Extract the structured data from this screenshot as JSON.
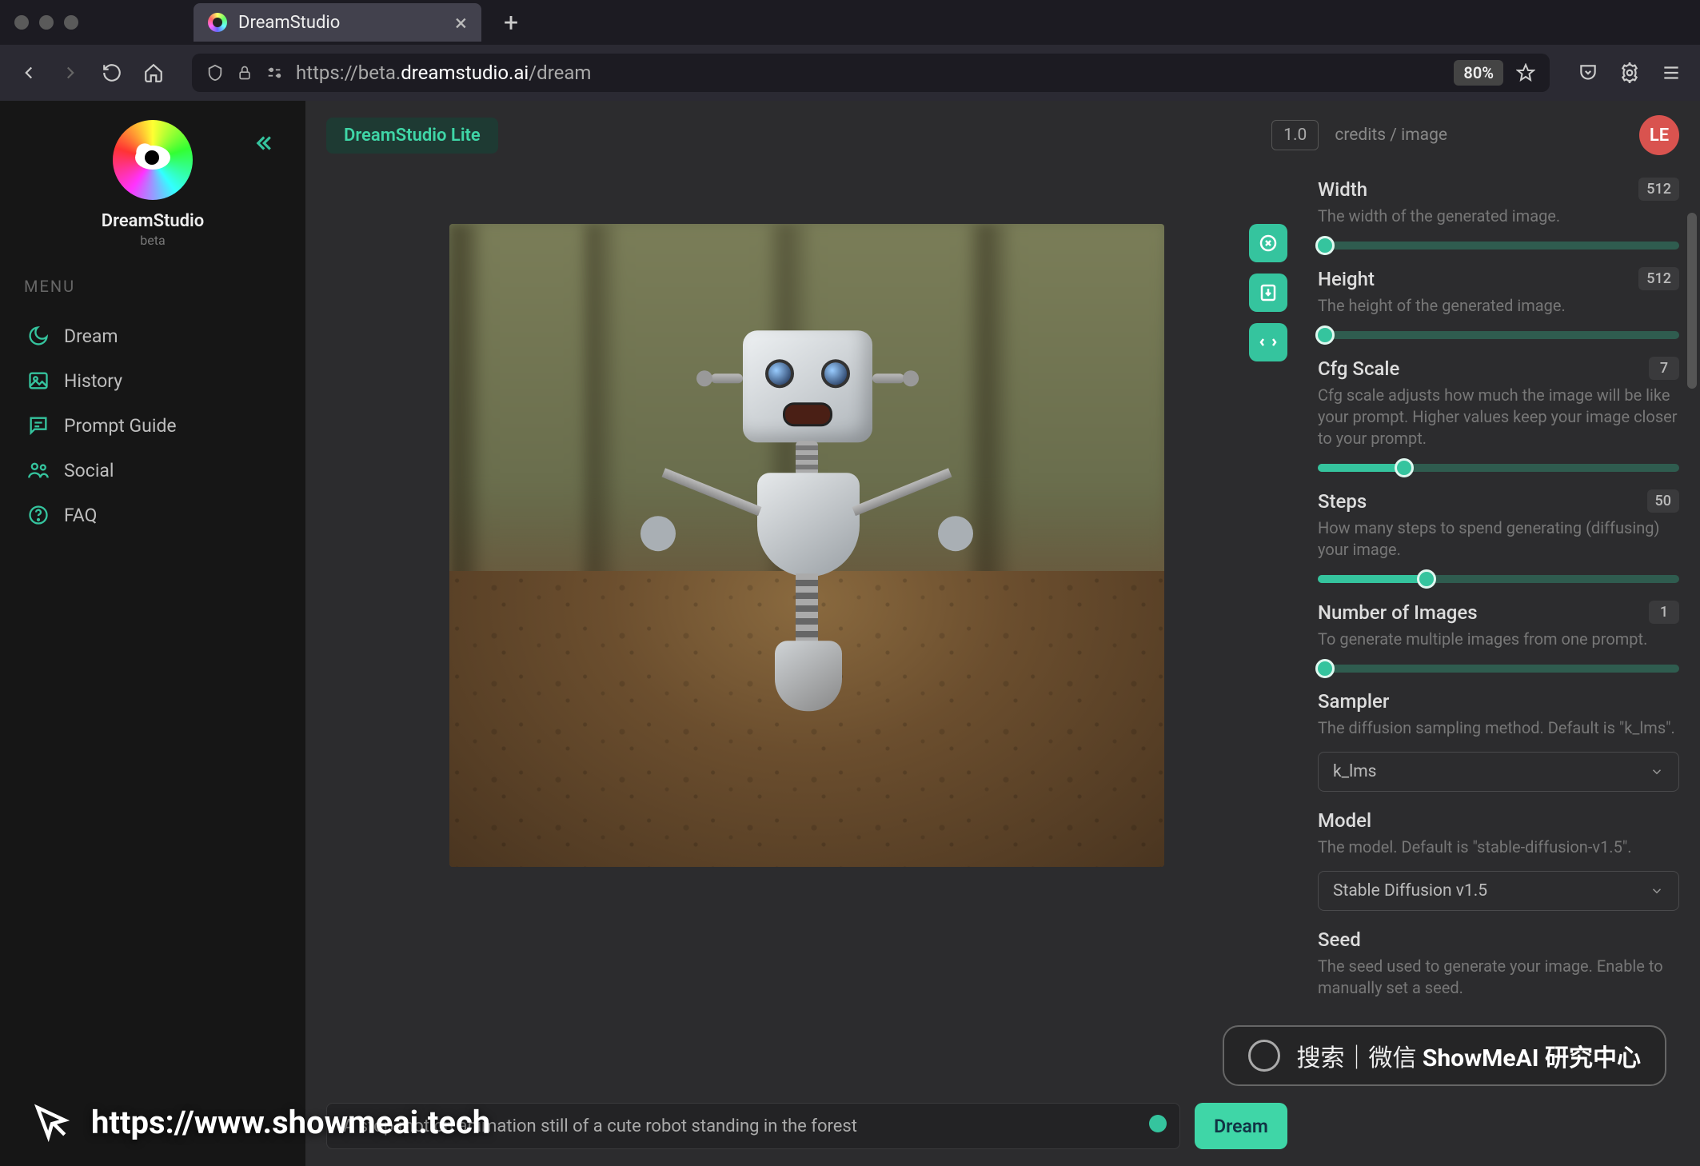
{
  "browser": {
    "tab_title": "DreamStudio",
    "url_prefix": "https://beta.",
    "url_domain": "dreamstudio.ai",
    "url_path": "/dream",
    "zoom": "80%"
  },
  "sidebar": {
    "brand": "DreamStudio",
    "brand_sub": "beta",
    "menu_label": "MENU",
    "items": [
      {
        "label": "Dream",
        "icon": "moon-icon"
      },
      {
        "label": "History",
        "icon": "image-icon"
      },
      {
        "label": "Prompt Guide",
        "icon": "chat-icon"
      },
      {
        "label": "Social",
        "icon": "users-icon"
      },
      {
        "label": "FAQ",
        "icon": "help-icon"
      }
    ]
  },
  "topbar": {
    "tag": "DreamStudio Lite",
    "credits_value": "1.0",
    "credits_label": "credits / image",
    "avatar": "LE"
  },
  "actions": {
    "close": "close-icon",
    "download": "download-icon",
    "redo": "redo-icon"
  },
  "settings": {
    "width": {
      "label": "Width",
      "desc": "The width of the generated image.",
      "value": "512",
      "pct": 2
    },
    "height": {
      "label": "Height",
      "desc": "The height of the generated image.",
      "value": "512",
      "pct": 2
    },
    "cfg": {
      "label": "Cfg Scale",
      "desc": "Cfg scale adjusts how much the image will be like your prompt. Higher values keep your image closer to your prompt.",
      "value": "7",
      "pct": 24
    },
    "steps": {
      "label": "Steps",
      "desc": "How many steps to spend generating (diffusing) your image.",
      "value": "50",
      "pct": 30
    },
    "num": {
      "label": "Number of Images",
      "desc": "To generate multiple images from one prompt.",
      "value": "1",
      "pct": 2
    },
    "sampler": {
      "label": "Sampler",
      "desc": "The diffusion sampling method. Default is \"k_lms\".",
      "value": "k_lms"
    },
    "model": {
      "label": "Model",
      "desc": "The model. Default is \"stable-diffusion-v1.5\".",
      "value": "Stable Diffusion v1.5"
    },
    "seed": {
      "label": "Seed",
      "desc": "The seed used to generate your image. Enable to manually set a seed."
    }
  },
  "prompt": {
    "value": "A stop-motion animation still of a cute  robot standing in the forest",
    "button": "Dream"
  },
  "watermark": {
    "url": "https://www.showmeai.tech",
    "pill_prefix": "搜索｜微信",
    "pill_bold": "ShowMeAI 研究中心"
  }
}
